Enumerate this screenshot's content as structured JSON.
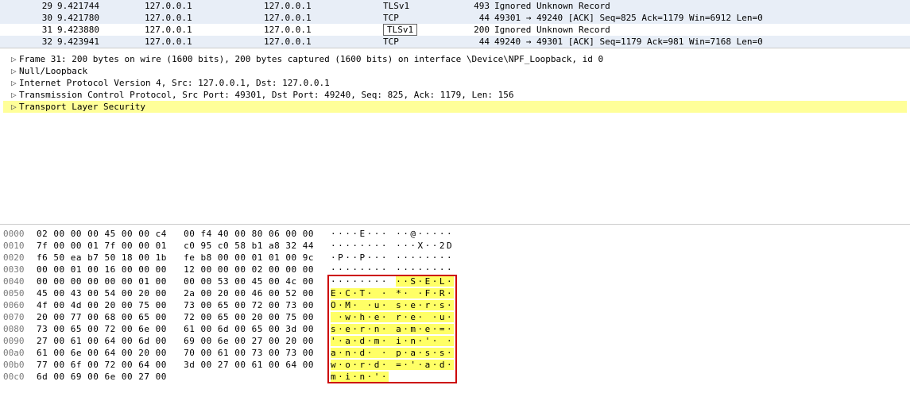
{
  "packet_list": [
    {
      "no": "29",
      "time": "9.421744",
      "src": "127.0.0.1",
      "dst": "127.0.0.1",
      "proto": "TLSv1",
      "len": "493",
      "info": "Ignored Unknown Record",
      "state": "normal"
    },
    {
      "no": "30",
      "time": "9.421780",
      "src": "127.0.0.1",
      "dst": "127.0.0.1",
      "proto": "TCP",
      "len": "44",
      "info": "49301 → 49240 [ACK] Seq=825 Ack=1179 Win=6912 Len=0",
      "state": "normal"
    },
    {
      "no": "31",
      "time": "9.423880",
      "src": "127.0.0.1",
      "dst": "127.0.0.1",
      "proto": "TLSv1",
      "len": "200",
      "info": "Ignored Unknown Record",
      "state": "selected"
    },
    {
      "no": "32",
      "time": "9.423941",
      "src": "127.0.0.1",
      "dst": "127.0.0.1",
      "proto": "TCP",
      "len": "44",
      "info": "49240 → 49301 [ACK] Seq=1179 Ack=981 Win=7168 Len=0",
      "state": "normal"
    }
  ],
  "tree": [
    {
      "label": "Frame 31: 200 bytes on wire (1600 bits), 200 bytes captured (1600 bits) on interface \\Device\\NPF_Loopback, id 0",
      "hl": false
    },
    {
      "label": "Null/Loopback",
      "hl": false
    },
    {
      "label": "Internet Protocol Version 4, Src: 127.0.0.1, Dst: 127.0.0.1",
      "hl": false
    },
    {
      "label": "Transmission Control Protocol, Src Port: 49301, Dst Port: 49240, Seq: 825, Ack: 1179, Len: 156",
      "hl": false
    },
    {
      "label": "Transport Layer Security",
      "hl": true
    }
  ],
  "hex": [
    {
      "off": "0000",
      "b1": "02 00 00 00 45 00 00 c4",
      "b2": "00 f4 40 00 80 06 00 00",
      "a": "····E··· ··@·····",
      "hl_start": -1
    },
    {
      "off": "0010",
      "b1": "7f 00 00 01 7f 00 00 01",
      "b2": "c0 95 c0 58 b1 a8 32 44",
      "a": "········ ···X··2D",
      "hl_start": -1
    },
    {
      "off": "0020",
      "b1": "f6 50 ea b7 50 18 00 1b",
      "b2": "fe b8 00 00 01 01 00 9c",
      "a": "·P··P··· ········",
      "hl_start": -1
    },
    {
      "off": "0030",
      "b1": "00 00 01 00 16 00 00 00",
      "b2": "12 00 00 00 02 00 00 00",
      "a": "········ ········",
      "hl_start": -1
    },
    {
      "off": "0040",
      "b1": "00 00 00 00 00 00 01 00",
      "b2": "00 00 53 00 45 00 4c 00",
      "a": "········ ··S·E·L·",
      "hl_start": 9
    },
    {
      "off": "0050",
      "b1": "45 00 43 00 54 00 20 00",
      "b2": "2a 00 20 00 46 00 52 00",
      "a": "E·C·T· · *· ·F·R·",
      "hl_start": 0
    },
    {
      "off": "0060",
      "b1": "4f 00 4d 00 20 00 75 00",
      "b2": "73 00 65 00 72 00 73 00",
      "a": "O·M· ·u· s·e·r·s·",
      "hl_start": 0
    },
    {
      "off": "0070",
      "b1": "20 00 77 00 68 00 65 00",
      "b2": "72 00 65 00 20 00 75 00",
      "a": " ·w·h·e· r·e· ·u·",
      "hl_start": 0
    },
    {
      "off": "0080",
      "b1": "73 00 65 00 72 00 6e 00",
      "b2": "61 00 6d 00 65 00 3d 00",
      "a": "s·e·r·n· a·m·e·=·",
      "hl_start": 0
    },
    {
      "off": "0090",
      "b1": "27 00 61 00 64 00 6d 00",
      "b2": "69 00 6e 00 27 00 20 00",
      "a": "'·a·d·m· i·n·'· ·",
      "hl_start": 0
    },
    {
      "off": "00a0",
      "b1": "61 00 6e 00 64 00 20 00",
      "b2": "70 00 61 00 73 00 73 00",
      "a": "a·n·d· · p·a·s·s·",
      "hl_start": 0
    },
    {
      "off": "00b0",
      "b1": "77 00 6f 00 72 00 64 00",
      "b2": "3d 00 27 00 61 00 64 00",
      "a": "w·o·r·d· =·'·a·d·",
      "hl_start": 0
    },
    {
      "off": "00c0",
      "b1": "6d 00 69 00 6e 00 27 00",
      "b2": "",
      "a": "m·i·n·'·",
      "hl_start": 0
    }
  ]
}
